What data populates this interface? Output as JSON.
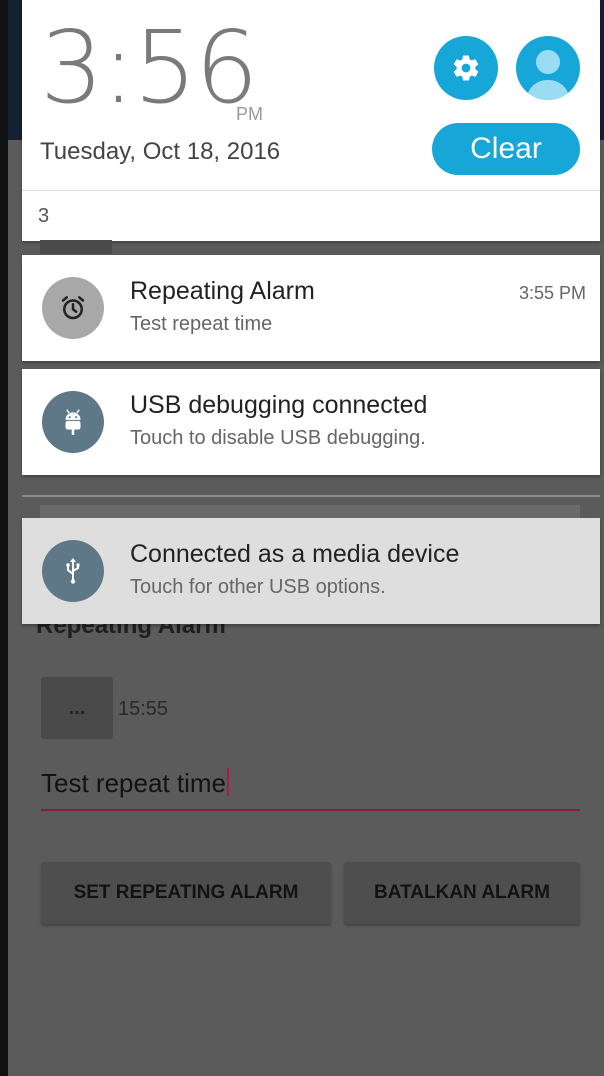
{
  "app": {
    "section_title": "Repeating Alarm",
    "time_button": "...",
    "time_value": "15:55",
    "message_value": "Test repeat time",
    "set_button": "SET REPEATING ALARM",
    "cancel_button": "BATALKAN ALARM"
  },
  "shade": {
    "clock": {
      "time": "3:56",
      "ampm": "PM",
      "date": "Tuesday, Oct 18, 2016"
    },
    "clear_label": "Clear",
    "overflow_count": "3",
    "accent_color": "#16a7d8"
  },
  "notifications": [
    {
      "icon": "alarm-clock-icon",
      "title": "Repeating Alarm",
      "text": "Test repeat time",
      "time": "3:55 PM"
    },
    {
      "icon": "android-icon",
      "title": "USB debugging connected",
      "text": "Touch to disable USB debugging.",
      "time": ""
    },
    {
      "icon": "usb-icon",
      "title": "Connected as a media device",
      "text": "Touch for other USB options.",
      "time": ""
    }
  ]
}
